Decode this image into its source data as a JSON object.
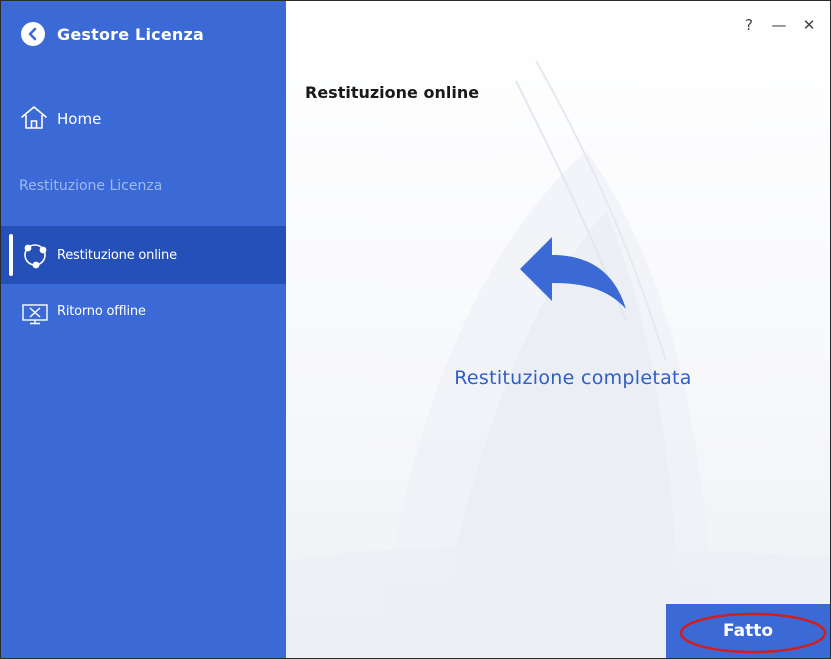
{
  "app": {
    "title": "Gestore Licenza",
    "brand_icon": "back-arrow-circle-icon"
  },
  "sidebar": {
    "home_label": "Home",
    "section_label": "Restituzione Licenza",
    "items": [
      {
        "label": "Restituzione online",
        "icon": "network-nodes-icon",
        "active": true
      },
      {
        "label": "Ritorno offline",
        "icon": "monitor-x-icon",
        "active": false
      }
    ]
  },
  "window_controls": {
    "help": "?",
    "minimize": "—",
    "close": "✕"
  },
  "main": {
    "title": "Restituzione online",
    "status": "Restituzione completata",
    "done_label": "Fatto"
  },
  "colors": {
    "sidebar": "#3b6ad6",
    "sidebar_active": "#2550b8",
    "accent_text": "#2f5fc4",
    "highlight_ring": "#d11f1f"
  }
}
